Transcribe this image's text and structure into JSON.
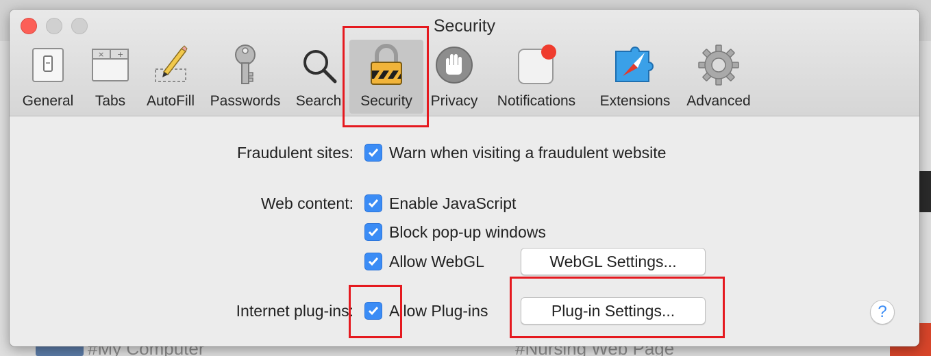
{
  "window": {
    "title": "Security"
  },
  "toolbar": {
    "items": [
      {
        "label": "General",
        "icon": "general-icon"
      },
      {
        "label": "Tabs",
        "icon": "tabs-icon"
      },
      {
        "label": "AutoFill",
        "icon": "autofill-icon"
      },
      {
        "label": "Passwords",
        "icon": "key-icon"
      },
      {
        "label": "Search",
        "icon": "magnifier-icon"
      },
      {
        "label": "Security",
        "icon": "lock-icon",
        "selected": true
      },
      {
        "label": "Privacy",
        "icon": "hand-icon"
      },
      {
        "label": "Notifications",
        "icon": "notifications-icon"
      },
      {
        "label": "Extensions",
        "icon": "puzzle-compass-icon"
      },
      {
        "label": "Advanced",
        "icon": "gear-icon"
      }
    ]
  },
  "settings": {
    "fraudulent": {
      "label": "Fraudulent sites:",
      "option": {
        "label": "Warn when visiting a fraudulent website",
        "checked": true
      }
    },
    "web_content": {
      "label": "Web content:",
      "options": [
        {
          "label": "Enable JavaScript",
          "checked": true
        },
        {
          "label": "Block pop-up windows",
          "checked": true
        },
        {
          "label": "Allow WebGL",
          "checked": true
        }
      ],
      "webgl_button": "WebGL Settings..."
    },
    "plugins": {
      "label": "Internet plug-ins:",
      "option": {
        "label": "Allow Plug-ins",
        "checked": true
      },
      "button": "Plug-in Settings..."
    },
    "help": "?"
  },
  "background": {
    "left_text": "#My Computer",
    "right_text": "#Nursing Web Page"
  },
  "colors": {
    "accent": "#3b8cf5",
    "highlight": "#e5191f",
    "close": "#fc5f57"
  }
}
